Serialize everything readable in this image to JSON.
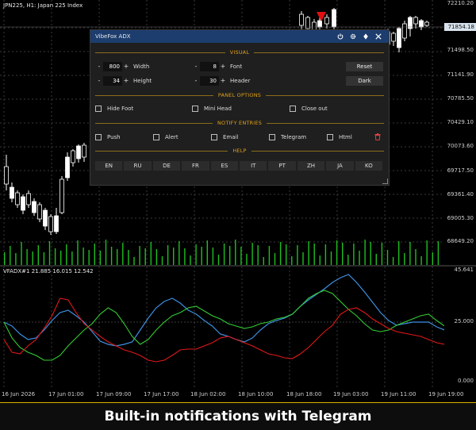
{
  "chart": {
    "title": "JPN225, H1:  Japan 225 Index",
    "current_price": "71854.18",
    "price_labels": [
      "72210.20",
      "71854.18",
      "71498.50",
      "71141.90",
      "70785.50",
      "70429.10",
      "70073.60",
      "69717.50",
      "69361.40",
      "69005.30",
      "68649.20"
    ],
    "candle_up_color": "#ffffff",
    "candle_down_color": "#ffffff",
    "volume_color": "#1fbf1f",
    "signal_arrow_color": "#e01010"
  },
  "indicator": {
    "title": "VFADX#1 21.885 16.015 12.542",
    "axis_labels": [
      "45.641",
      "25.000",
      "0.000"
    ],
    "adx_color": "#3d8fe0",
    "plus_di_color": "#33cc33",
    "minus_di_color": "#e01818"
  },
  "time_axis": [
    "16 Jun 2026",
    "17 Jun 01:00",
    "17 Jun 09:00",
    "17 Jun 17:00",
    "18 Jun 02:00",
    "18 Jun 10:00",
    "18 Jun 18:00",
    "19 Jun 03:00",
    "19 Jun 11:00",
    "19 Jun 19:00"
  ],
  "panel": {
    "title": "VibeFox ADX",
    "icons": [
      "power-icon",
      "settings-icon",
      "theme-icon",
      "close-icon"
    ],
    "visual_label": "VISUAL",
    "width": {
      "value": "800",
      "label": "Width"
    },
    "height": {
      "value": "34",
      "label": "Height"
    },
    "font": {
      "value": "8",
      "label": "Font"
    },
    "header": {
      "value": "30",
      "label": "Header"
    },
    "minus": "-",
    "plus": "+",
    "reset_label": "Reset",
    "dark_label": "Dark",
    "panel_options_label": "PANEL OPTIONS",
    "hide_foot": "Hide Foot",
    "mini_head": "Mini Head",
    "close_out": "Close out",
    "notify_label": "NOTIFY ENTRIES",
    "push": "Push",
    "alert": "Alert",
    "email": "Email",
    "telegram": "Telegram",
    "html": "Html",
    "help_label": "HELP",
    "languages": [
      "EN",
      "RU",
      "DE",
      "FR",
      "ES",
      "IT",
      "PT",
      "ZH",
      "JA",
      "KO"
    ]
  },
  "caption": "Built-in notifications with Telegram"
}
